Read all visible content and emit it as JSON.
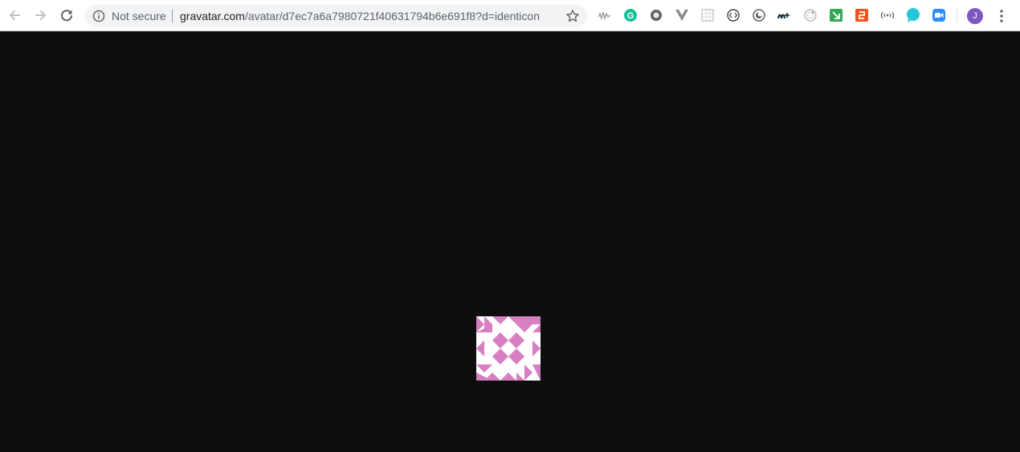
{
  "browser": {
    "security_label": "Not secure",
    "url_host": "gravatar.com",
    "url_path": "/avatar/d7ec7a6a7980721f40631794b6e691f8?d=identicon",
    "profile_initial": "J",
    "profile_color": "#7e57c2"
  },
  "toolbar_icons": [
    "back-arrow-icon",
    "forward-arrow-icon",
    "reload-icon",
    "info-icon",
    "bookmark-star-icon",
    "kebab-menu-icon"
  ],
  "extensions": [
    {
      "name": "ext-wave-icon",
      "color": "#9aa0a6"
    },
    {
      "name": "ext-grammarly-icon",
      "color": "#15c39a"
    },
    {
      "name": "ext-circle-icon",
      "color": "#5f6368"
    },
    {
      "name": "ext-vue-devtools-icon",
      "color": "#8a8a8a"
    },
    {
      "name": "ext-grid-icon",
      "color": "#c8c8c8"
    },
    {
      "name": "ext-code-icon",
      "color": "#3c4043"
    },
    {
      "name": "ext-dark-mode-icon",
      "color": "#5f6368"
    },
    {
      "name": "ext-movistar-icon",
      "color": "#0b2739"
    },
    {
      "name": "ext-dial-icon",
      "color": "#b0b0b0"
    },
    {
      "name": "ext-green-arrow-icon",
      "color": "#34a853"
    },
    {
      "name": "ext-orange-icon",
      "color": "#f4511e"
    },
    {
      "name": "ext-antenna-icon",
      "color": "#5f6368"
    },
    {
      "name": "ext-teal-bubble-icon",
      "color": "#26c6da"
    },
    {
      "name": "ext-zoom-icon",
      "color": "#2d8cff"
    }
  ],
  "page": {
    "background": "#0e0e0e",
    "identicon": {
      "name": "gravatar-identicon-image",
      "pattern_color": "#d77fc1",
      "background": "#ffffff"
    }
  }
}
